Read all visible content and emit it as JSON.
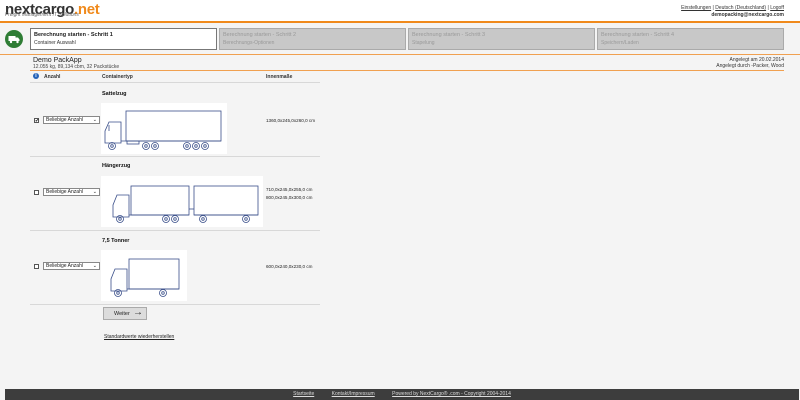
{
  "brand": {
    "name_part1": "nextcargo",
    "dot": ".",
    "name_part2": "net",
    "tagline": "Freight Management IT Solutions",
    "accent": "#f08a1c"
  },
  "toplinks": {
    "settings": "Einstellungen",
    "language": "Deutsch (Deutschland)",
    "logoff": "Logoff",
    "sep": "|",
    "user": "demopacking@nextcargo.com"
  },
  "steps": [
    {
      "title": "Berechnung starten - Schritt 1",
      "subtitle": "Container Auswahl",
      "active": true
    },
    {
      "title": "Berechnung starten - Schritt 2",
      "subtitle": "Berechnungs-Optionen",
      "active": false
    },
    {
      "title": "Berechnung starten - Schritt 3",
      "subtitle": "Stapelung",
      "active": false
    },
    {
      "title": "Berechnung starten - Schritt 4",
      "subtitle": "Speichern/Laden",
      "active": false
    }
  ],
  "app": {
    "name": "Demo PackApp",
    "summary": "12.055 kg, 89,134 cbm, 32 Packstücke",
    "created_on": "Angelegt am 20.02.2014",
    "created_by": "Angelegt durch -Packer, Wood"
  },
  "table": {
    "headers": {
      "info": "i",
      "quantity": "Anzahl",
      "type": "Containertyp",
      "dims": "Innenmaße"
    },
    "rows": [
      {
        "checked": true,
        "check_mark": "✔",
        "select": "Beliebige Anzahl",
        "type": "Sattelzug",
        "dims": [
          "1360,0x245,0x260,0 cm"
        ]
      },
      {
        "checked": false,
        "check_mark": "",
        "select": "Beliebige Anzahl",
        "type": "Hängerzug",
        "dims": [
          "710,0x245,0x255,0 cm",
          "800,0x245,0x300,0 cm"
        ]
      },
      {
        "checked": false,
        "check_mark": "",
        "select": "Beliebige Anzahl",
        "type": "7,5 Tonner",
        "dims": [
          "600,0x240,0x230,0 cm"
        ]
      }
    ]
  },
  "actions": {
    "next": "Weiter",
    "next_arrow": "→",
    "reset": "Standardwerte wiederherstellen"
  },
  "footer": {
    "home": "Startseite",
    "contact": "Kontakt/Impressum",
    "powered": "Powered by NextCargo® .com - Copyright 2004-2014"
  }
}
